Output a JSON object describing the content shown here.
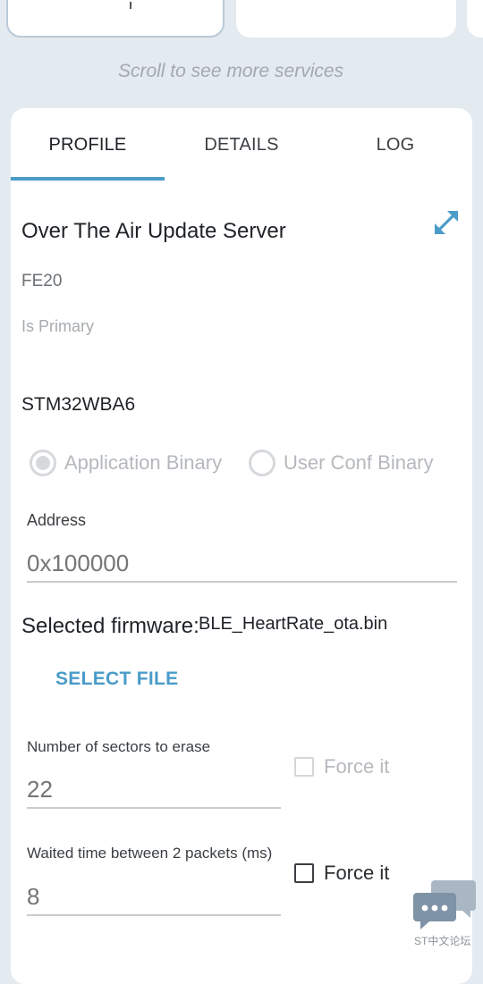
{
  "scroll_hint": "Scroll to see more services",
  "tabs": [
    {
      "label": "PROFILE",
      "selected": true
    },
    {
      "label": "DETAILS",
      "selected": false
    },
    {
      "label": "LOG",
      "selected": false
    }
  ],
  "service": {
    "title": "Over The Air Update Server",
    "uuid": "FE20",
    "primary_label": "Is Primary",
    "board": "STM32WBA6"
  },
  "binary_type": {
    "options": [
      {
        "label": "Application Binary",
        "selected": true,
        "enabled": false
      },
      {
        "label": "User Conf Binary",
        "selected": false,
        "enabled": false
      }
    ]
  },
  "address": {
    "label": "Address",
    "placeholder": "0x100000"
  },
  "firmware": {
    "label": "Selected firmware:",
    "filename": "BLE_HeartRate_ota.bin",
    "select_button": "SELECT FILE"
  },
  "sectors": {
    "label": "Number of sectors to erase",
    "placeholder": "22",
    "force_label": "Force it",
    "force_checked": false,
    "force_enabled": false
  },
  "wait_time": {
    "label": "Waited time between 2 packets (ms)",
    "placeholder": "8",
    "force_label": "Force it",
    "force_checked": false,
    "force_enabled": true
  },
  "watermark": "ST中文论坛",
  "colors": {
    "accent": "#4a9cc9",
    "background": "#e3eaf0",
    "card": "#ffffff"
  },
  "icons": {
    "expand": "expand-icon",
    "chat": "chat-bubbles-icon"
  }
}
